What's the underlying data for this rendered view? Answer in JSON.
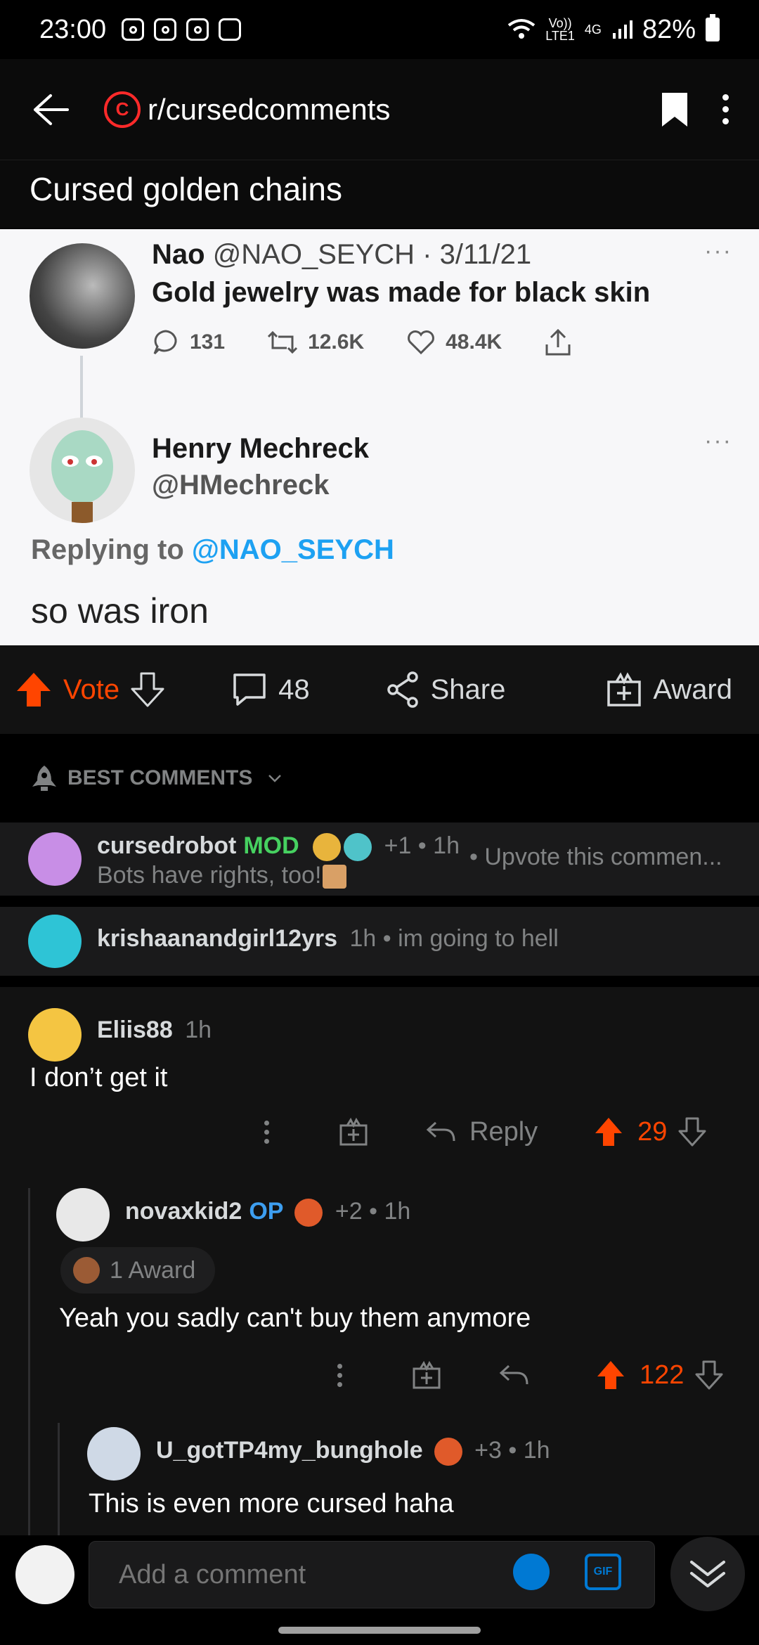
{
  "status_bar": {
    "time": "23:00",
    "network_top": "Vo))",
    "network_bottom": "LTE1",
    "network_type": "4G",
    "battery": "82%"
  },
  "header": {
    "subreddit": "r/cursedcomments",
    "sub_logo_letter": "C"
  },
  "post": {
    "title": "Cursed golden chains",
    "tweet": {
      "author_name": "Nao",
      "author_handle_date": "@NAO_SEYCH · 3/11/21",
      "text": "Gold jewelry was made for black skin",
      "replies": "131",
      "retweets": "12.6K",
      "likes": "48.4K",
      "reply_name": "Henry Mechreck",
      "reply_handle": "@HMechreck",
      "replying_to_prefix": "Replying to",
      "replying_to_mention": "@NAO_SEYCH",
      "reply_text": "so was iron",
      "dots": "···"
    },
    "actions": {
      "vote": "Vote",
      "comments": "48",
      "share": "Share",
      "award": "Award"
    }
  },
  "sort": {
    "label": "BEST COMMENTS"
  },
  "pinned": [
    {
      "user": "cursedrobot",
      "badge": "MOD",
      "meta": "+1 • 1h",
      "body": "Bots have rights, too!",
      "preview": "• Upvote this commen..."
    },
    {
      "user": "krishaanandgirl12yrs",
      "meta": "1h • ",
      "inline_text": "im going to hell"
    }
  ],
  "comments": [
    {
      "user": "Eliis88",
      "meta": "1h",
      "body": "I don’t get it",
      "reply": "Reply",
      "score": "29"
    },
    {
      "user": "novaxkid2",
      "badge": "OP",
      "meta": "+2 • 1h",
      "award": "1 Award",
      "body": "Yeah you sadly can't buy them anymore",
      "score": "122"
    },
    {
      "user": "U_gotTP4my_bunghole",
      "meta": "+3 • 1h",
      "body": "This is even more cursed haha"
    }
  ],
  "composer": {
    "placeholder": "Add a comment",
    "gif": "GIF"
  },
  "colors": {
    "upvote": "#ff4500",
    "mod": "#46d160",
    "op": "#3d9ef0",
    "link": "#1da1f2",
    "accent": "#0079d3"
  }
}
